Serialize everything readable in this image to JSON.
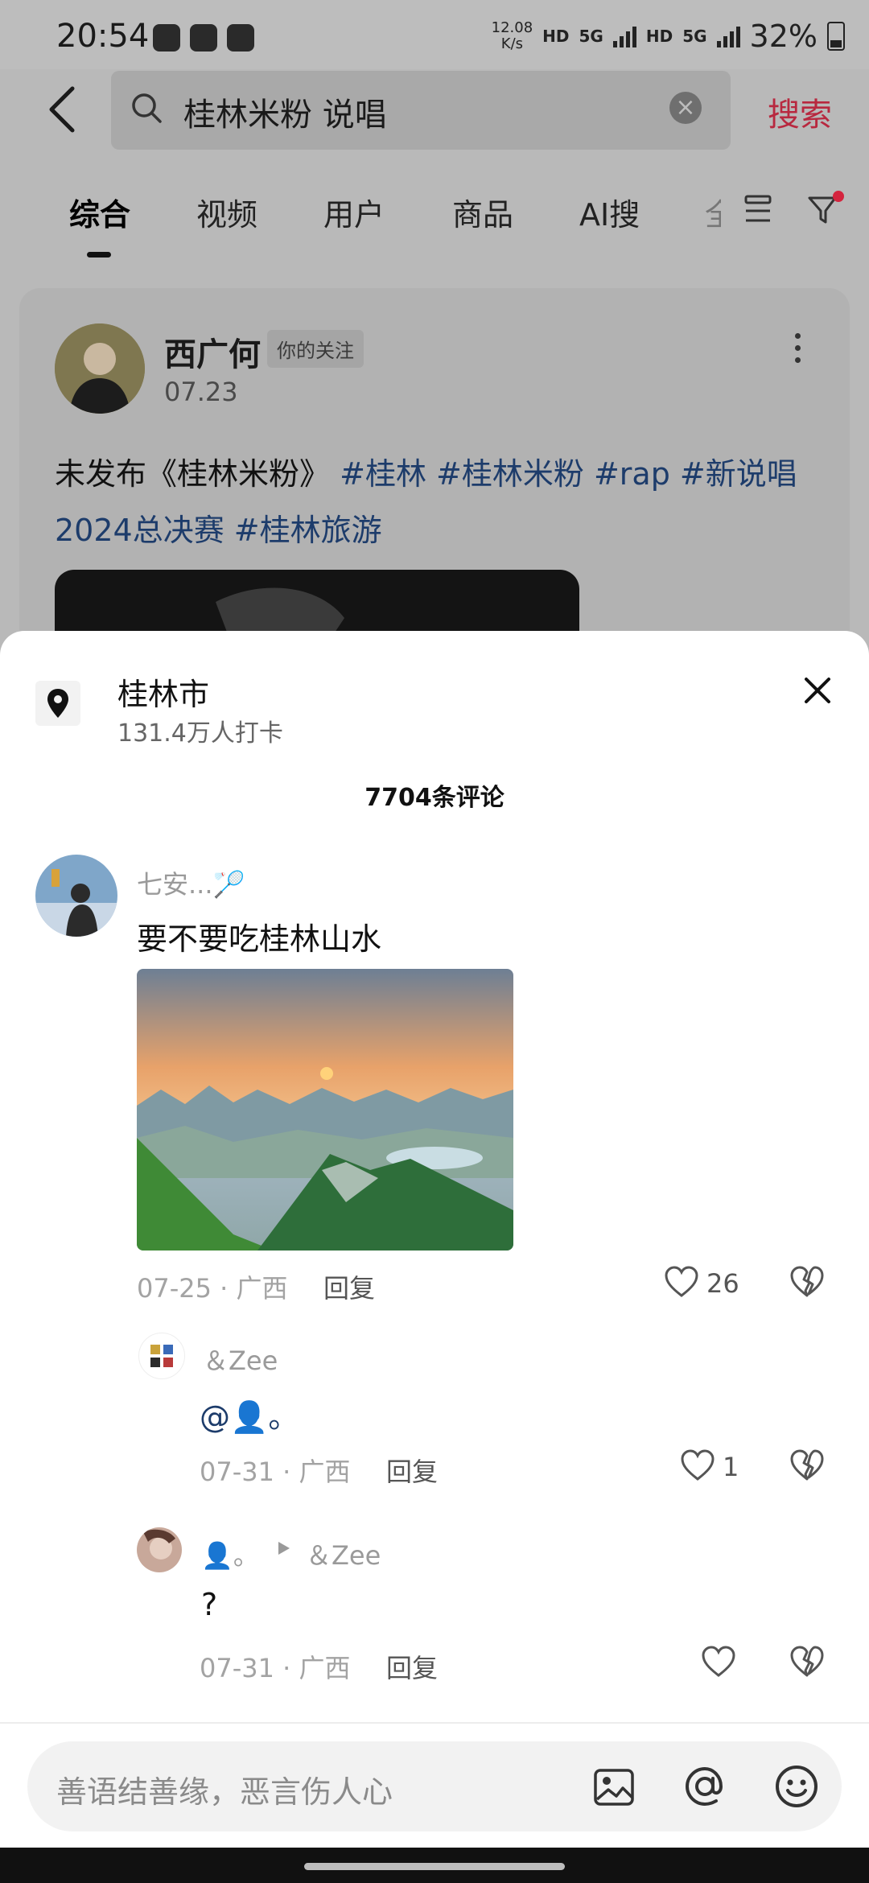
{
  "status": {
    "time": "20:54",
    "net_speed_value": "12.08",
    "net_speed_unit": "K/s",
    "hd1": "HD",
    "sig1": "5G",
    "hd2": "HD",
    "sig2": "5G",
    "battery": "32%"
  },
  "search": {
    "query": "桂林米粉 说唱",
    "button": "搜索"
  },
  "tabs": [
    "综合",
    "视频",
    "用户",
    "商品",
    "AI搜",
    "全"
  ],
  "post": {
    "author": "西广何",
    "follow_tag": "你的关注",
    "date": "07.23",
    "text_plain": "未发布《桂林米粉》",
    "tags_line1": "#桂林 #桂林米粉 #rap #新说唱",
    "tags_line2": "2024总决赛 #桂林旅游"
  },
  "sheet": {
    "location_name": "桂林市",
    "location_sub": "131.4万人打卡",
    "comment_count": "7704条评论"
  },
  "comments": [
    {
      "user": "七安...🏸",
      "text": "要不要吃桂林山水",
      "meta": "07-25 · 广西",
      "reply": "回复",
      "likes": "26"
    },
    {
      "user": "＆Zee",
      "text": "@👤。",
      "meta": "07-31 · 广西",
      "reply": "回复",
      "likes": "1"
    },
    {
      "user": "👤。",
      "reply_to": "＆Zee",
      "text": "?",
      "meta": "07-31 · 广西",
      "reply": "回复",
      "likes": ""
    }
  ],
  "input": {
    "placeholder": "善语结善缘，恶言伤人心"
  },
  "icons": {
    "accent": "#b8283f",
    "link": "#1d3c6b"
  }
}
